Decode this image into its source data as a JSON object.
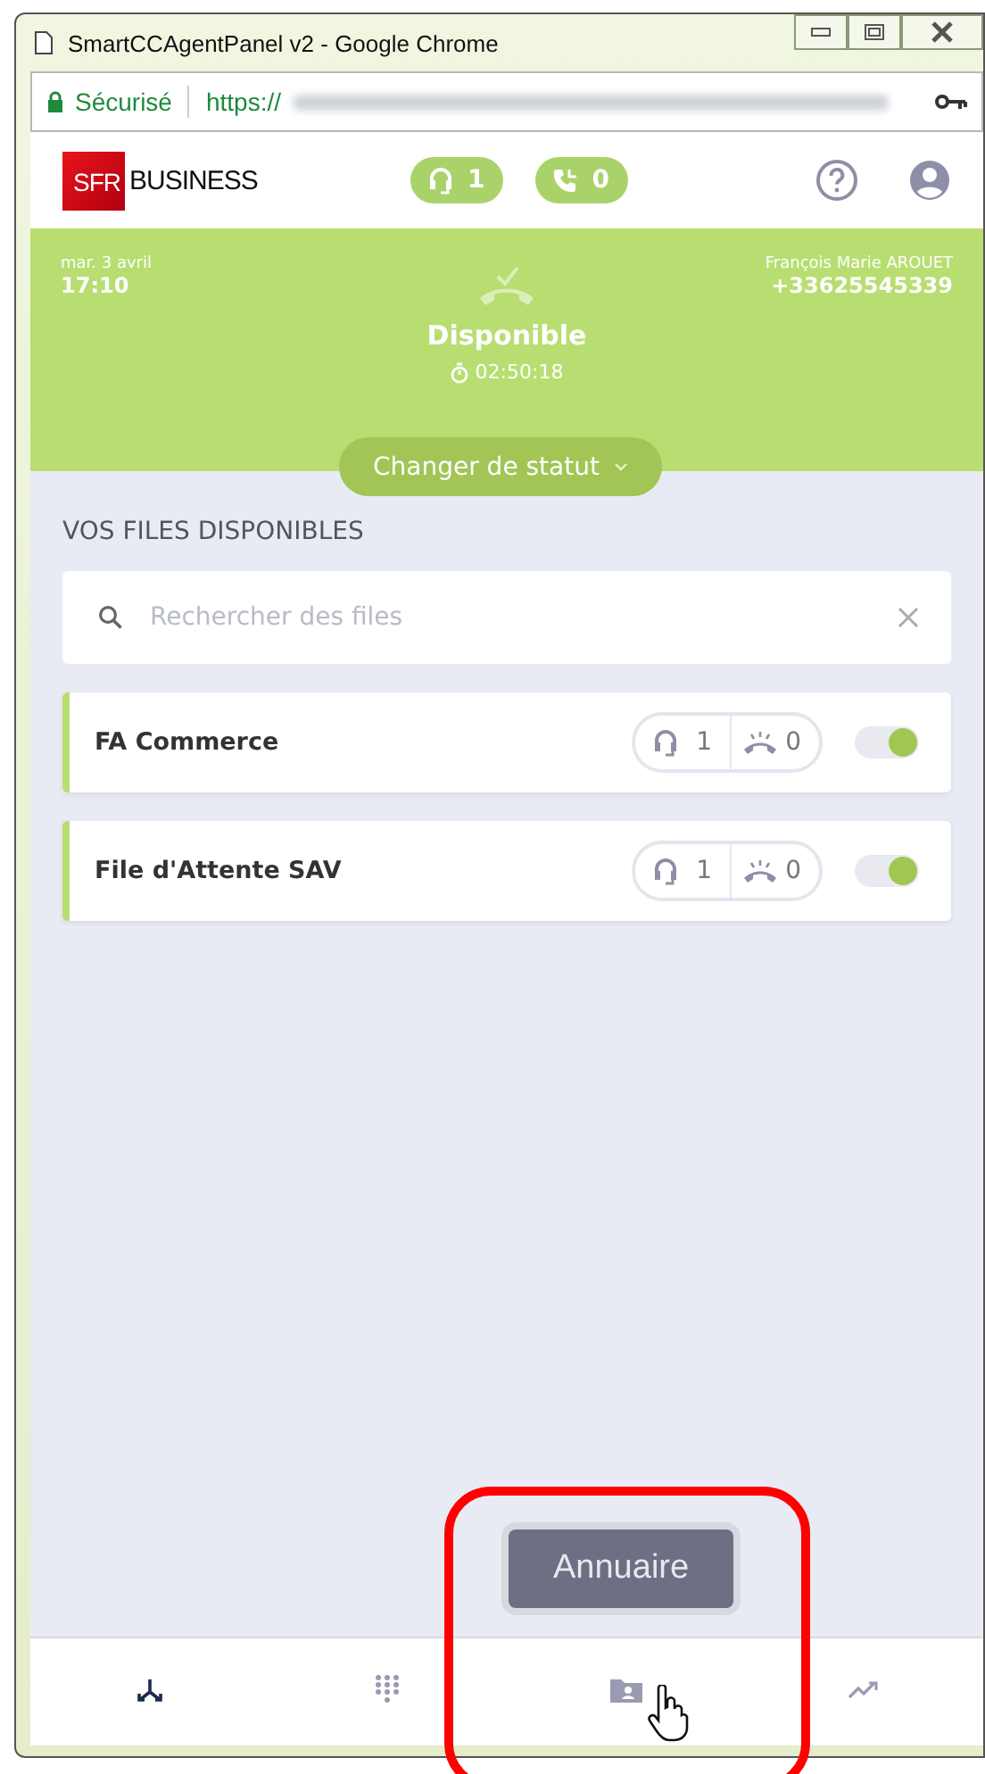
{
  "window": {
    "title": "SmartCCAgentPanel v2 - Google Chrome"
  },
  "address_bar": {
    "security": "Sécurisé",
    "url": "https://"
  },
  "header": {
    "logo_mark": "SFR",
    "logo_text": "BUSINESS",
    "badges": [
      {
        "kind": "agents",
        "count": "1"
      },
      {
        "kind": "calls",
        "count": "0"
      }
    ]
  },
  "status_panel": {
    "date": "mar. 3 avril",
    "time": "17:10",
    "agent_name": "François Marie AROUET",
    "agent_phone": "+33625545339",
    "status": "Disponible",
    "timer": "02:50:18",
    "change_button": "Changer de statut"
  },
  "queues_section": {
    "title": "VOS FILES DISPONIBLES",
    "search": {
      "placeholder": "Rechercher des files"
    },
    "queues": [
      {
        "name": "FA Commerce",
        "agents": "1",
        "waiting": "0",
        "on": true
      },
      {
        "name": "File d'Attente SAV",
        "agents": "1",
        "waiting": "0",
        "on": true
      }
    ]
  },
  "tooltip": "Annuaire",
  "bottom_nav": [
    {
      "kind": "transfer",
      "selected": true
    },
    {
      "kind": "dialpad",
      "selected": false
    },
    {
      "kind": "directory",
      "selected": false
    },
    {
      "kind": "stats",
      "selected": false
    }
  ]
}
